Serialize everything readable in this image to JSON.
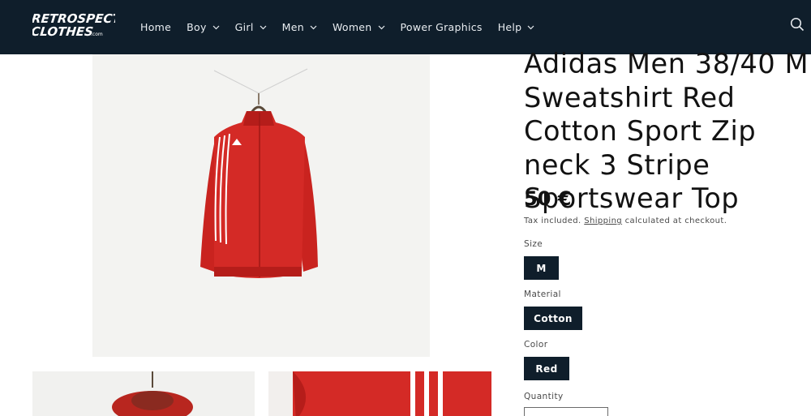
{
  "header": {
    "logo_text_line1": "RETROSPECT",
    "logo_text_line2": "CLOTHES",
    "logo_text_suffix": ".com",
    "nav": [
      {
        "label": "Home",
        "has_dropdown": false
      },
      {
        "label": "Boy",
        "has_dropdown": true
      },
      {
        "label": "Girl",
        "has_dropdown": true
      },
      {
        "label": "Men",
        "has_dropdown": true
      },
      {
        "label": "Women",
        "has_dropdown": true
      },
      {
        "label": "Power Graphics",
        "has_dropdown": false
      },
      {
        "label": "Help",
        "has_dropdown": true
      }
    ],
    "search_icon": "search-icon"
  },
  "product": {
    "title": "Adidas Men 38/40 M Sweatshirt Red Cotton Sport Zip neck 3 Stripe Sportswear Top",
    "price": "50 €",
    "tax_prefix": "Tax included.",
    "shipping_link": "Shipping",
    "tax_suffix": "calculated at checkout.",
    "options": {
      "size_label": "Size",
      "size_value": "M",
      "material_label": "Material",
      "material_value": "Cotton",
      "color_label": "Color",
      "color_value": "Red",
      "quantity_label": "Quantity"
    }
  },
  "colors": {
    "header_bg": "#0f1e2b",
    "pill_bg": "#0f1e2b",
    "garment_red": "#d42a26"
  }
}
